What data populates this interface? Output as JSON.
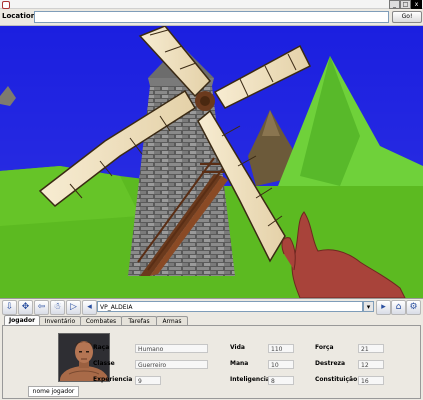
{
  "window": {
    "buttons": [
      "_",
      "□",
      "x"
    ]
  },
  "location": {
    "label": "Location:",
    "value": "",
    "go_label": "Go!"
  },
  "viewpoint": {
    "value": "VP_ALDEIA",
    "dropdown_glyph": "▾"
  },
  "nav_icons": [
    "nav-down-icon",
    "nav-move-icon",
    "nav-back-icon",
    "nav-walk-icon",
    "nav-play-icon",
    "nav-prev-icon",
    "nav-next-icon",
    "home-icon",
    "settings-icon"
  ],
  "tabs": [
    {
      "label": "Jogador",
      "active": true
    },
    {
      "label": "Inventário",
      "active": false
    },
    {
      "label": "Combates",
      "active": false
    },
    {
      "label": "Tarefas",
      "active": false
    },
    {
      "label": "Armas",
      "active": false
    }
  ],
  "player": {
    "name": "nome jogador",
    "stats": {
      "raca_label": "Raça",
      "raca_value": "Humano",
      "classe_label": "Classe",
      "classe_value": "Guerreiro",
      "experiencia_label": "Experiencia",
      "experiencia_value": "9",
      "vida_label": "Vida",
      "vida_value": "110",
      "mana_label": "Mana",
      "mana_value": "10",
      "inteligencia_label": "Inteligencia",
      "inteligencia_value": "8",
      "forca_label": "Força",
      "forca_value": "21",
      "destreza_label": "Destreza",
      "destreza_value": "12",
      "constituicao_label": "Constituição",
      "constituicao_value": "16"
    }
  },
  "colors": {
    "sky": "#1b1fe0",
    "grass": "#5cba21",
    "tab_active": "#fcfcfc",
    "panel_bg": "#ece9e2"
  }
}
